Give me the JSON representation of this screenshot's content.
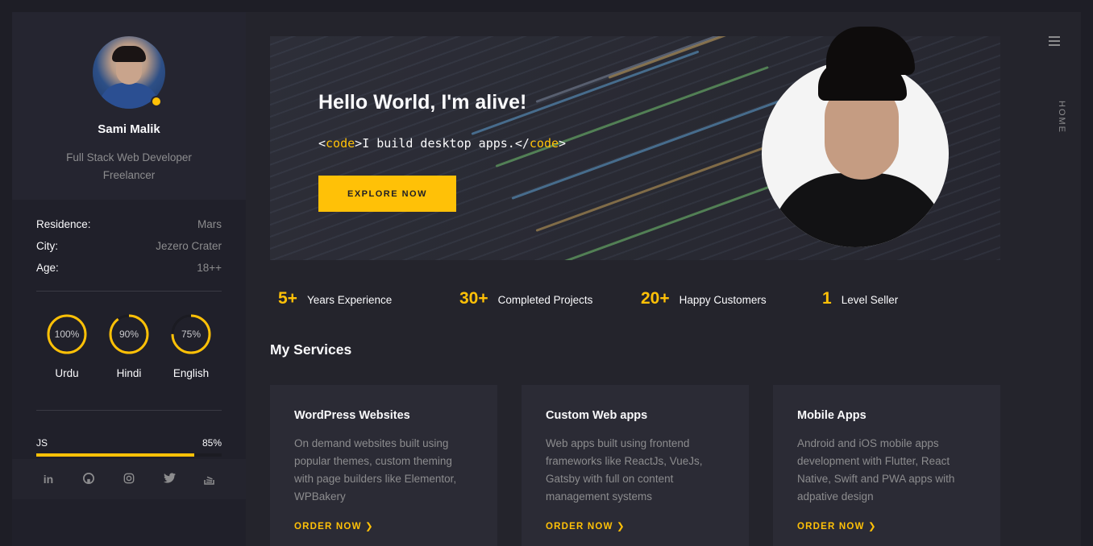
{
  "profile": {
    "name": "Sami Malik",
    "role_line1": "Full Stack Web Developer",
    "role_line2": "Freelancer"
  },
  "info": [
    {
      "key": "Residence:",
      "value": "Mars"
    },
    {
      "key": "City:",
      "value": "Jezero Crater"
    },
    {
      "key": "Age:",
      "value": "18++"
    }
  ],
  "languages": [
    {
      "name": "Urdu",
      "percent_label": "100%",
      "percent": 100
    },
    {
      "name": "Hindi",
      "percent_label": "90%",
      "percent": 90
    },
    {
      "name": "English",
      "percent_label": "75%",
      "percent": 75
    }
  ],
  "skill": {
    "name": "JS",
    "percent_label": "85%",
    "percent": 85
  },
  "socials": [
    "linkedin-icon",
    "github-icon",
    "instagram-icon",
    "twitter-icon",
    "stackoverflow-icon"
  ],
  "hero": {
    "title": "Hello World, I'm alive!",
    "code_open": "<",
    "code_tag": "code",
    "code_close": ">",
    "code_text": "I build desktop apps.",
    "code_end_open": "</",
    "button": "EXPLORE NOW"
  },
  "stats": [
    {
      "num": "5+",
      "label": "Years Experience"
    },
    {
      "num": "30+",
      "label": "Completed Projects"
    },
    {
      "num": "20+",
      "label": "Happy Customers"
    },
    {
      "num": "1",
      "label": "Level Seller"
    }
  ],
  "services_title": "My Services",
  "services": [
    {
      "title": "WordPress Websites",
      "desc": "On demand websites built using popular themes, custom theming with page builders like Elementor, WPBakery",
      "link": "ORDER NOW"
    },
    {
      "title": "Custom Web apps",
      "desc": "Web apps built using frontend frameworks like ReactJs, VueJs, Gatsby with full on content management systems",
      "link": "ORDER NOW"
    },
    {
      "title": "Mobile Apps",
      "desc": "Android and iOS mobile apps development with Flutter, React Native, Swift and PWA apps with adpative design",
      "link": "ORDER NOW"
    }
  ],
  "nav": {
    "home": "HOME"
  },
  "colors": {
    "accent": "#ffc107",
    "bg": "#24242c",
    "muted": "#8c8c8e"
  }
}
